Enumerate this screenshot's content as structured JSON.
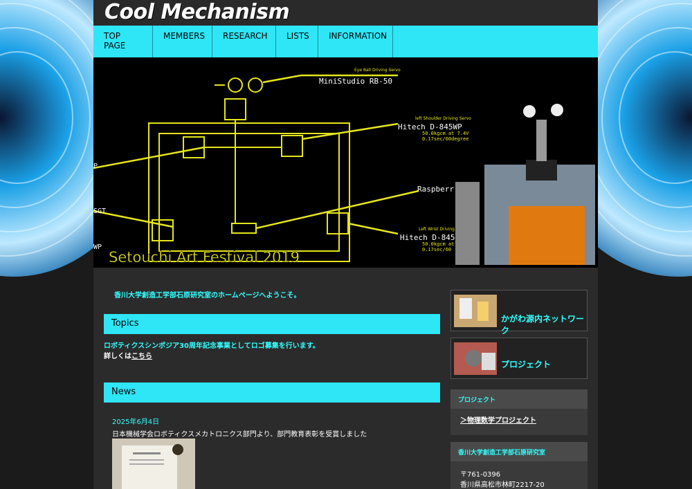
{
  "site": {
    "logo": "Cool Mechanism"
  },
  "nav": [
    {
      "label": "TOP PAGE"
    },
    {
      "label": "MEMBERS"
    },
    {
      "label": "RESEARCH"
    },
    {
      "label": "LISTS"
    },
    {
      "label": "INFORMATION"
    }
  ],
  "hero": {
    "caption": "Setouchi Art Festival 2019",
    "labels": {
      "eye_small": "Eye Ball Driving Servo",
      "eye_big": "MiniStudio RB-50",
      "ls_small": "left Shoulder Driving Servo",
      "ls_big": "Hitech D-845WP",
      "ls_spec1": "50.0kgcm at 7.4V",
      "ls_spec2": "0.17sec/60degree",
      "rasp": "Raspberr",
      "lw_small": "Left Wrist Driving",
      "lw_big": "Hitech D-845",
      "lw_spec1": "50.0kgcm at",
      "lw_spec2": "0.17sec/60",
      "edge_p": "P",
      "edge_sgt": "SGT",
      "edge_wp": "WP"
    }
  },
  "welcome": "香川大学創造工学部石原研究室のホームページへようこそ。",
  "topics": {
    "heading": "Topics",
    "line1": "ロボティクスシンポジア30周年記念事業としてロゴ募集を行います。",
    "line2_prefix": "詳しくは",
    "line2_link": "こちら"
  },
  "news": {
    "heading": "News",
    "date": "2025年6月4日",
    "text": "日本機械学会ロボティクスメカトロニクス部門より、部門教育表彰を受賞しました"
  },
  "sidebar": {
    "banner1": "かがわ源内ネットワーク",
    "banner2": "プロジェクト",
    "project_head": "プロジェクト",
    "project_link": "＞物理数学プロジェクト",
    "lab_head": "香川大学創造工学部石原研究室",
    "postal": "〒761-0396",
    "address": "香川県高松市林町2217-20"
  },
  "colors": {
    "accent": "#2ee6f5",
    "background": "#222222",
    "panel": "#2b2b2b"
  }
}
